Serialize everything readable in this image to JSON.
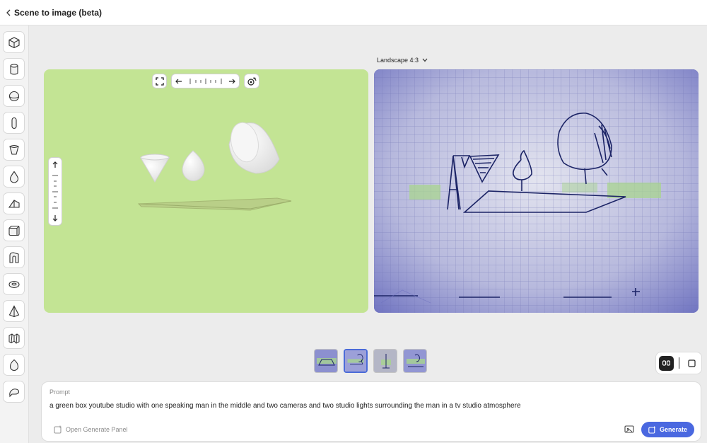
{
  "app": {
    "title": "Scene to image (beta)"
  },
  "toolbar": {
    "tools": [
      "cube",
      "cylinder",
      "sphere",
      "capsule",
      "cone-cup",
      "drop",
      "wedge",
      "rounded-cube",
      "arch",
      "torus",
      "pyramid",
      "terrain",
      "egg",
      "speech-bubble"
    ]
  },
  "aspect": {
    "label": "Landscape 4:3"
  },
  "thumbnails": {
    "count": 4,
    "selected_index": 1
  },
  "prompt": {
    "label": "Prompt",
    "text": "a green box youtube studio with one speaking man in the middle and two cameras and two studio lights surrounding the man in a tv studio atmosphere",
    "open_panel_label": "Open Generate Panel",
    "generate_label": "Generate"
  },
  "colors": {
    "viewport_bg": "#c3e494",
    "accent": "#4a68e0",
    "output_tint": "#7f82c7"
  }
}
